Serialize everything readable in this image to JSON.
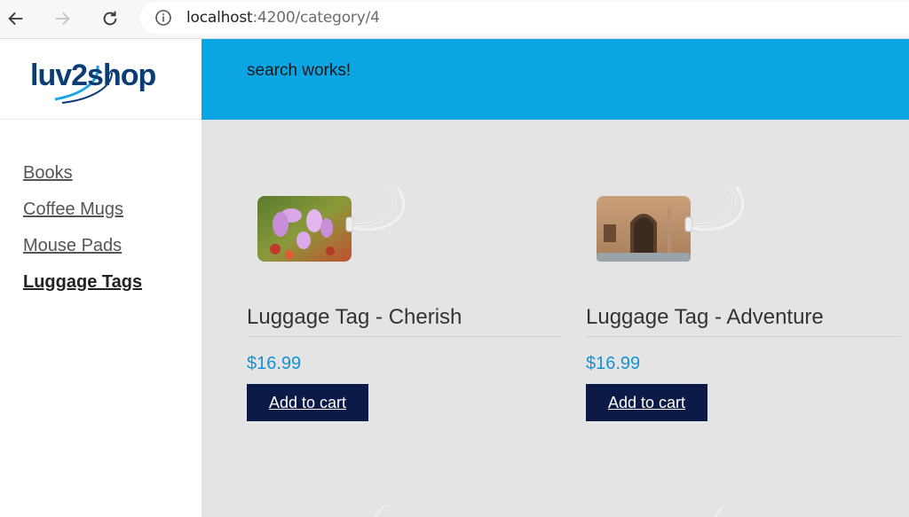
{
  "browser": {
    "url_host": "localhost",
    "url_path": ":4200/category/4"
  },
  "sidebar": {
    "logo_text": "luv2shop",
    "menu": [
      {
        "label": "Books",
        "active": false
      },
      {
        "label": "Coffee Mugs",
        "active": false
      },
      {
        "label": "Mouse Pads",
        "active": false
      },
      {
        "label": "Luggage Tags",
        "active": true
      }
    ]
  },
  "header": {
    "search_text": "search works!"
  },
  "products": [
    {
      "title": "Luggage Tag - Cherish",
      "price": "$16.99",
      "button": "Add to cart",
      "image": "flowers-luggage-tag"
    },
    {
      "title": "Luggage Tag - Adventure",
      "price": "$16.99",
      "button": "Add to cart",
      "image": "doorway-luggage-tag"
    }
  ],
  "colors": {
    "header": "#0ba5e3",
    "button": "#0c1a48",
    "price": "#1592d6",
    "background": "#e4e4e4"
  }
}
